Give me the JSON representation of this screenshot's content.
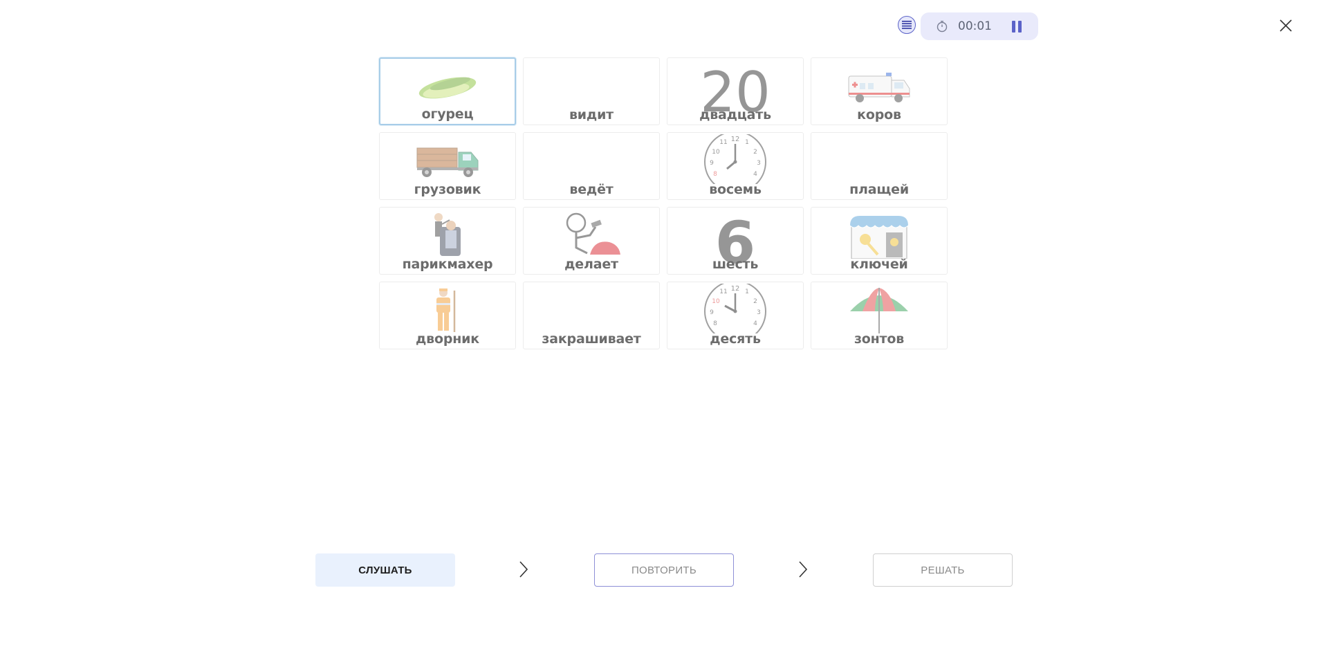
{
  "header": {
    "timer": "00:01",
    "icons": {
      "list": "list-icon",
      "timer": "stopwatch-icon",
      "pause": "pause-icon",
      "close": "close-icon"
    }
  },
  "cards": [
    {
      "word": "огурец",
      "image": "cucumber",
      "selected": true
    },
    {
      "word": "видит",
      "image": "none"
    },
    {
      "word": "двадцать",
      "image": "number-20"
    },
    {
      "word": "коров",
      "image": "ambulance"
    },
    {
      "word": "грузовик",
      "image": "truck"
    },
    {
      "word": "ведёт",
      "image": "none"
    },
    {
      "word": "восемь",
      "image": "clock-8"
    },
    {
      "word": "плащей",
      "image": "none"
    },
    {
      "word": "парикмахер",
      "image": "hairdresser"
    },
    {
      "word": "делает",
      "image": "person-hammering"
    },
    {
      "word": "шесть",
      "image": "number-6"
    },
    {
      "word": "ключей",
      "image": "key-shop"
    },
    {
      "word": "дворник",
      "image": "janitor"
    },
    {
      "word": "закрашивает",
      "image": "none"
    },
    {
      "word": "десять",
      "image": "clock-10"
    },
    {
      "word": "зонтов",
      "image": "umbrella"
    }
  ],
  "big_numbers": {
    "twenty": "20",
    "six": "6"
  },
  "clock_numbers": [
    "12",
    "1",
    "2",
    "3",
    "4",
    "8",
    "9",
    "10",
    "11"
  ],
  "controls": {
    "listen": "СЛУШАТЬ",
    "repeat": "ПОВТОРИТЬ",
    "solve": "РЕШАТЬ"
  },
  "colors": {
    "accent": "#5b62c8",
    "listen_bg": "#e9f1fd",
    "selected_border": "#a8cde8"
  }
}
